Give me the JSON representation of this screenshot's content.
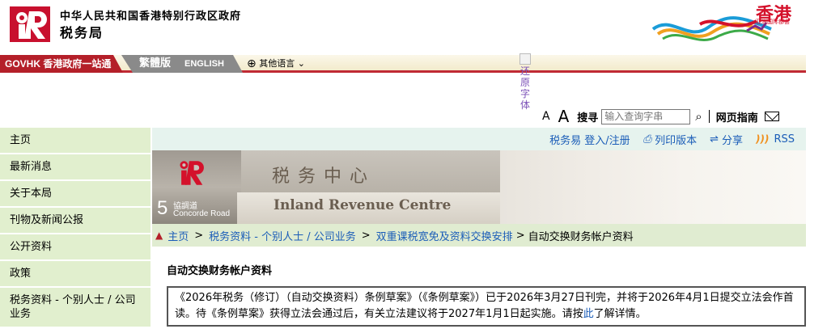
{
  "header": {
    "gov_name": "中华人民共和国香港特别行政区政府",
    "dept_name": "税务局",
    "brand_name": "香港",
    "brand_tagline": "亚洲国际都会"
  },
  "topbar": {
    "govhk_label": "GOVHK 香港政府一站通",
    "lang_trad": "繁體版",
    "lang_en": "ENGLISH",
    "other_lang": "其他语言"
  },
  "restore_label": "还原字体",
  "tools": {
    "font_small": "A",
    "font_large": "A",
    "search_label": "搜寻",
    "search_placeholder": "输入查询字串",
    "guide": "网页指南"
  },
  "sidebar": {
    "items": [
      {
        "label": "主页"
      },
      {
        "label": "最新消息"
      },
      {
        "label": "关于本局"
      },
      {
        "label": "刊物及新闻公报"
      },
      {
        "label": "公开资料"
      },
      {
        "label": "政策"
      },
      {
        "label": "税务资料 - 个别人士 / 公司业务"
      }
    ]
  },
  "linkbar": {
    "etax": "税务易 登入/注册",
    "print": "列印版本",
    "share": "分享",
    "rss": "RSS"
  },
  "banner": {
    "building_cn": "税务中心",
    "building_en": "Inland Revenue Centre",
    "address_num": "5",
    "address_cn": "協調道",
    "address_en": "Concorde Road"
  },
  "breadcrumb": {
    "home": "主页",
    "level1": "税务资料 - 个别人士 / 公司业务",
    "level2": "双重课税宽免及资料交换安排",
    "current": "自动交换财务帐户资料"
  },
  "main": {
    "title": "自动交换财务帐户资料",
    "notice_text": "《2026年税务（修订）（自动交换资料）条例草案》（《条例草案》）已于2026年3月27日刊完，并将于2026年4月1日提交立法会作首读。待《条例草案》获得立法会通过后，有关立法建议将于2027年1月1日起实施。请按",
    "notice_link": "此",
    "notice_tail": "了解详情。"
  },
  "colors": {
    "govhk_red": "#b41f29",
    "link_blue": "#1b5db8",
    "sidebar_green": "#e1efce"
  }
}
